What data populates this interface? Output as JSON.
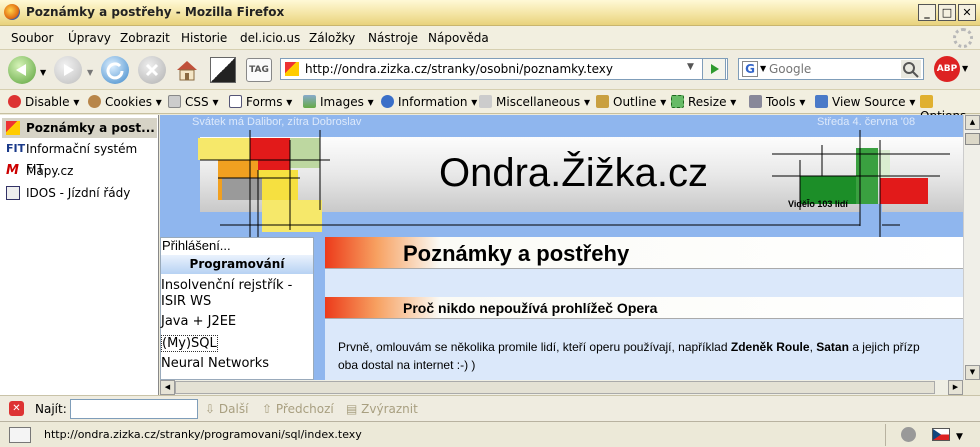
{
  "window": {
    "title": "Poznámky a postřehy - Mozilla Firefox"
  },
  "menu": [
    "Soubor",
    "Úpravy",
    "Zobrazit",
    "Historie",
    "del.icio.us",
    "Záložky",
    "Nástroje",
    "Nápověda"
  ],
  "nav": {
    "url": "http://ondra.zizka.cz/stranky/osobni/poznamky.texy",
    "search_placeholder": "Google",
    "tag_label": "TAG",
    "abp_label": "ABP"
  },
  "devbar": [
    "Disable",
    "Cookies",
    "CSS",
    "Forms",
    "Images",
    "Information",
    "Miscellaneous",
    "Outline",
    "Resize",
    "Tools",
    "View Source",
    "Options"
  ],
  "sidebar": [
    "Poznámky a post...",
    "Informační systém FIT",
    "Mapy.cz",
    "IDOS - Jízdní řády"
  ],
  "page": {
    "nameday": "Svátek má Dalibor, zítra Dobroslav",
    "date": "Středa 4. června '08",
    "site_title": "Ondra.Žižka.cz",
    "visits": "Viděl̄o 103 lidí",
    "login": "Přihlášení...",
    "menu_heading": "Programování",
    "menu_items": [
      "Insolvenční rejstřík - ISIR WS",
      "Java + J2EE",
      "(My)SQL",
      "Neural Networks"
    ],
    "heading": "Poznámky a postřehy",
    "subheading": "Proč nikdo nepoužívá prohlížeč Opera",
    "para_1": "Prvně, omlouvám se několika promile lidí, kteří operu používají, například",
    "name_1": "Zdeněk Roule",
    "comma": ",",
    "name_2": "Satan",
    "para_2": "a jejich přízp",
    "para_3": "oba dostal na internet :-) )"
  },
  "findbar": {
    "label": "Najít:",
    "next": "Další",
    "prev": "Předchozí",
    "highlight": "Zvýraznit"
  },
  "status": {
    "url": "http://ondra.zizka.cz/stranky/programovani/sql/index.texy"
  }
}
